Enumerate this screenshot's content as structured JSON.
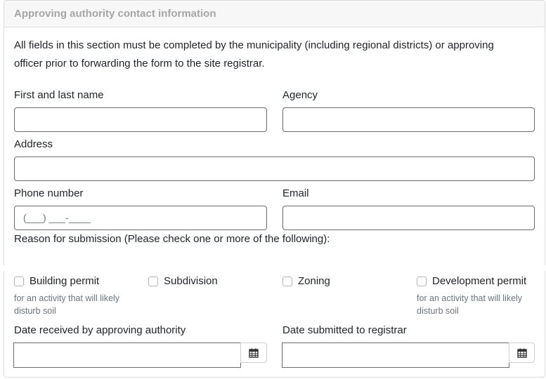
{
  "section": {
    "title": "Approving authority contact information",
    "intro_line1": "All fields in this section must be completed by the municipality (including regional districts) or approving",
    "intro_line2": "officer prior to forwarding the form to the site registrar."
  },
  "fields": {
    "name_label": "First and last name",
    "name_value": "",
    "agency_label": "Agency",
    "agency_value": "",
    "address_label": "Address",
    "address_value": "",
    "phone_label": "Phone number",
    "phone_placeholder": "(___) ___-____",
    "email_label": "Email",
    "email_value": ""
  },
  "reason": {
    "label": "Reason for submission (Please check one or more of the following):",
    "options": [
      {
        "label": "Building permit",
        "checked": false,
        "note_line1": "for an activity that will likely",
        "note_line2": "disturb soil"
      },
      {
        "label": "Subdivision",
        "checked": false
      },
      {
        "label": "Zoning",
        "checked": false
      },
      {
        "label": "Development permit",
        "checked": false,
        "note_line1": "for an activity that will likely",
        "note_line2": "disturb soil"
      }
    ]
  },
  "dates": {
    "received_label": "Date received by approving authority",
    "received_value": "",
    "submitted_label": "Date submitted to registrar",
    "submitted_value": ""
  },
  "icons": {
    "calendar": "calendar-icon"
  }
}
